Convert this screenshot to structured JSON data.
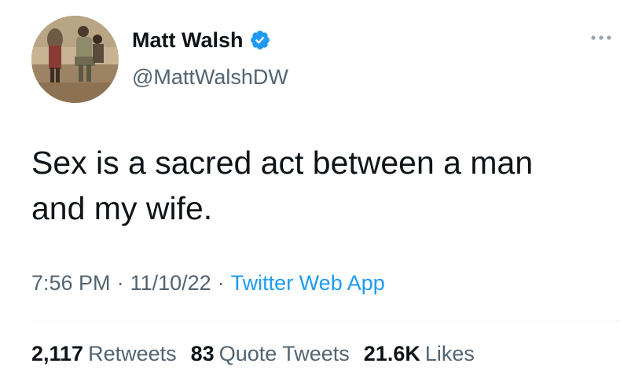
{
  "author": {
    "display_name": "Matt Walsh",
    "handle": "@MattWalshDW",
    "verified": true,
    "verified_icon": "verified-badge-icon",
    "avatar": "profile-photo"
  },
  "tweet": {
    "text": "Sex is a sacred act between a man\nand my wife."
  },
  "meta": {
    "time": "7:56 PM",
    "separator": "·",
    "date": "11/10/22",
    "source": "Twitter Web App"
  },
  "stats": {
    "retweets_count": "2,117",
    "retweets_label": "Retweets",
    "quotes_count": "83",
    "quotes_label": "Quote Tweets",
    "likes_count": "21.6K",
    "likes_label": "Likes"
  },
  "colors": {
    "text_primary": "#0f1419",
    "text_secondary": "#536471",
    "accent": "#1d9bf0",
    "divider": "#eff3f4"
  }
}
